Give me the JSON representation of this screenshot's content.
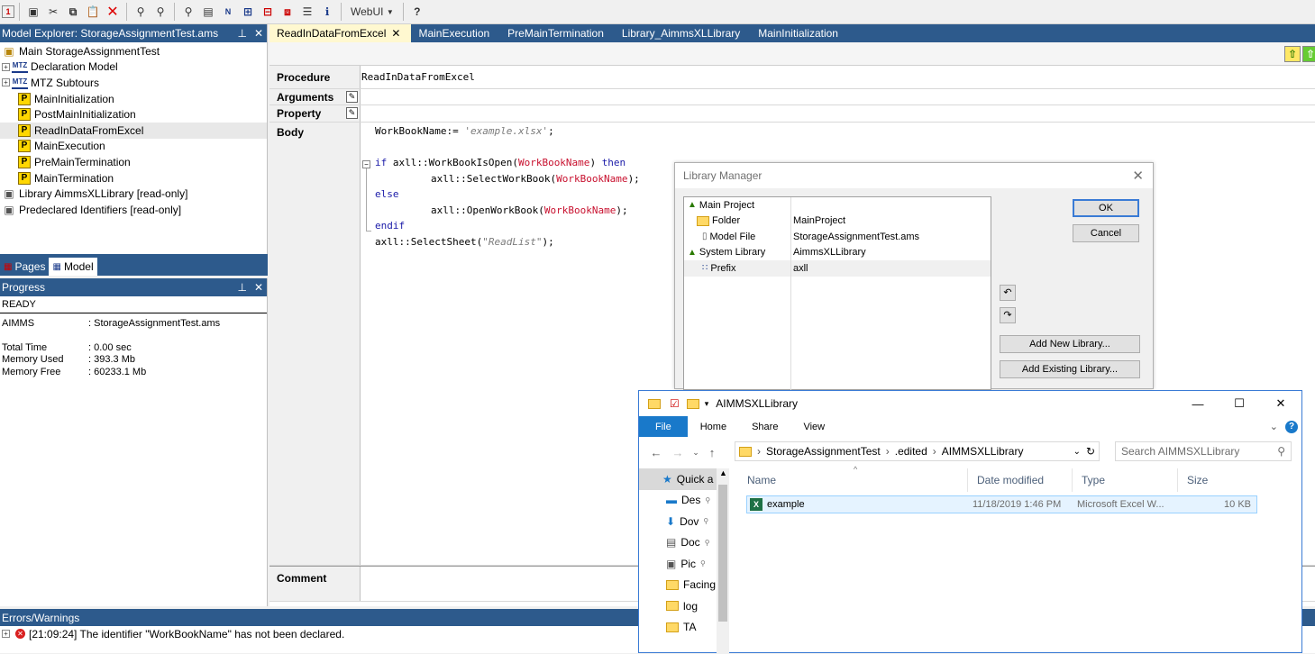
{
  "toolbar": {
    "webui_label": "WebUI",
    "icons": [
      "app-icon",
      "save-icon",
      "cut-icon",
      "copy-icon",
      "paste-icon",
      "delete-icon",
      "find-icon",
      "find-next-icon",
      "binoculars-icon",
      "properties-icon",
      "identifier-icon",
      "tree-icon",
      "wizard-icon",
      "settings-icon",
      "info-icon",
      "help-icon"
    ]
  },
  "model_explorer": {
    "title": "Model Explorer: StorageAssignmentTest.ams",
    "items": [
      {
        "label": "Main StorageAssignmentTest",
        "level": 0,
        "icon": "main-model-icon"
      },
      {
        "label": "Declaration Model",
        "level": 1,
        "icon": "mtz-icon",
        "expandable": true
      },
      {
        "label": "MTZ Subtours",
        "level": 1,
        "icon": "mtz-icon",
        "expandable": true
      },
      {
        "label": "MainInitialization",
        "level": 2,
        "icon": "procedure-icon"
      },
      {
        "label": "PostMainInitialization",
        "level": 2,
        "icon": "procedure-icon"
      },
      {
        "label": "ReadInDataFromExcel",
        "level": 2,
        "icon": "procedure-icon",
        "selected": true
      },
      {
        "label": "MainExecution",
        "level": 2,
        "icon": "procedure-icon"
      },
      {
        "label": "PreMainTermination",
        "level": 2,
        "icon": "procedure-icon"
      },
      {
        "label": "MainTermination",
        "level": 2,
        "icon": "procedure-icon"
      },
      {
        "label": "Library AimmsXLLibrary [read-only]",
        "level": 0,
        "icon": "library-icon"
      },
      {
        "label": "Predeclared Identifiers [read-only]",
        "level": 0,
        "icon": "library-icon"
      }
    ],
    "tabs": [
      {
        "label": "Pages",
        "active": false
      },
      {
        "label": "Model",
        "active": true
      }
    ]
  },
  "progress": {
    "title": "Progress",
    "status": "READY",
    "rows": [
      {
        "key": "AIMMS",
        "value": ": StorageAssignmentTest.ams"
      },
      {
        "key": "",
        "value": ""
      },
      {
        "key": "Total Time",
        "value": ": 0.00 sec"
      },
      {
        "key": "Memory Used",
        "value": ": 393.3 Mb"
      },
      {
        "key": "Memory Free",
        "value": ": 60233.1 Mb"
      }
    ]
  },
  "editor": {
    "tabs": [
      {
        "label": "ReadInDataFromExcel",
        "active": true
      },
      {
        "label": "MainExecution"
      },
      {
        "label": "PreMainTermination"
      },
      {
        "label": "Library_AimmsXLLibrary"
      },
      {
        "label": "MainInitialization"
      }
    ],
    "procedure_label": "Procedure",
    "procedure_value": "ReadInDataFromExcel",
    "arguments_label": "Arguments",
    "property_label": "Property",
    "body_label": "Body",
    "comment_label": "Comment"
  },
  "errors": {
    "title": "Errors/Warnings",
    "message": "[21:09:24]  The identifier \"WorkBookName\" has not been declared."
  },
  "library_manager": {
    "title": "Library Manager",
    "tree": [
      {
        "name": "Main Project",
        "value": ""
      },
      {
        "name": "Folder",
        "value": "MainProject"
      },
      {
        "name": "Model File",
        "value": "StorageAssignmentTest.ams"
      },
      {
        "name": "System Library",
        "value": "AimmsXLLibrary"
      },
      {
        "name": "Prefix",
        "value": "axll"
      }
    ],
    "ok_label": "OK",
    "cancel_label": "Cancel",
    "add_new_label": "Add New Library...",
    "add_existing_label": "Add Existing Library..."
  },
  "file_explorer": {
    "title": "AIMMSXLLibrary",
    "ribbon_tabs": [
      "File",
      "Home",
      "Share",
      "View"
    ],
    "breadcrumb": [
      "StorageAssignmentTest",
      ".edited",
      "AIMMSXLLibrary"
    ],
    "search_placeholder": "Search AIMMSXLLibrary",
    "nav_items": [
      {
        "label": "Quick a",
        "icon": "star-icon"
      },
      {
        "label": "Des",
        "icon": "desktop-icon"
      },
      {
        "label": "Dov",
        "icon": "download-icon"
      },
      {
        "label": "Doc",
        "icon": "document-icon"
      },
      {
        "label": "Pic",
        "icon": "pictures-icon"
      },
      {
        "label": "Facing",
        "icon": "folder-icon"
      },
      {
        "label": "log",
        "icon": "folder-icon"
      },
      {
        "label": "TA",
        "icon": "folder-icon"
      }
    ],
    "columns": [
      "Name",
      "Date modified",
      "Type",
      "Size"
    ],
    "files": [
      {
        "name": "example",
        "date": "11/18/2019 1:46 PM",
        "type": "Microsoft Excel W...",
        "size": "10 KB"
      }
    ]
  }
}
